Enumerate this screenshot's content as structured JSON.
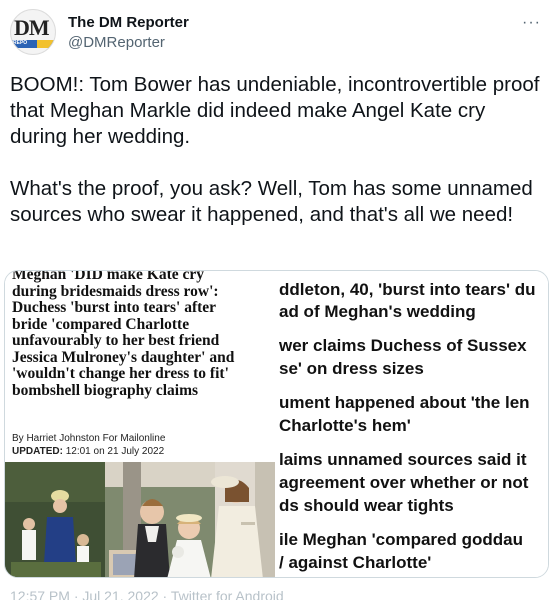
{
  "account": {
    "name": "The DM Reporter",
    "handle": "@DMReporter",
    "avatar_text": "DM",
    "avatar_subtext": "REPO"
  },
  "menu": {
    "more_icon": "···"
  },
  "tweet": {
    "text": "BOOM!: Tom Bower has undeniable, incontrovertible proof that Meghan Markle did indeed make Angel Kate cry during her wedding.\n\nWhat's the proof, you ask? Well, Tom has some unnamed sources who swear it happened, and that's all we need!"
  },
  "article": {
    "headline": "Meghan 'DID make Kate cry\nduring bridesmaids dress row':\nDuchess 'burst into tears' after\nbride 'compared Charlotte\nunfavourably to her best friend\nJessica Mulroney's daughter' and\n'wouldn't change her dress to fit'\nbombshell biography claims",
    "byline": "By Harriet Johnston For Mailonline",
    "updated_label": "UPDATED:",
    "updated_value": " 12:01 on 21 July 2022"
  },
  "snippets": [
    "ddleton, 40, 'burst into tears' du",
    "ad of Meghan's wedding",
    "wer claims Duchess of Sussex",
    "se' on dress sizes",
    "ument happened about 'the len",
    "Charlotte's hem'",
    "laims unnamed sources said it",
    "agreement over whether or not",
    "ds should wear tights",
    "ile Meghan 'compared goddau",
    "/ against Charlotte'"
  ],
  "footer": {
    "partial": "12:57 PM · Jul 21, 2022 · Twitter for Android"
  },
  "colors": {
    "text": "#0f1419",
    "secondary": "#536471",
    "border": "#cfd9de",
    "avatar_band": "#2b63b5"
  }
}
